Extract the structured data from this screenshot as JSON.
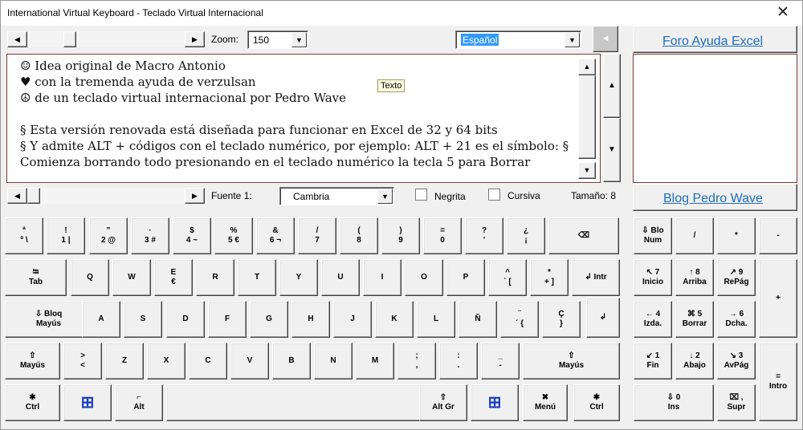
{
  "window": {
    "title": "International Virtual Keyboard - Teclado Virtual Internacional",
    "close_glyph": "✕"
  },
  "toolbar": {
    "zoom_label": "Zoom:",
    "zoom_value": "150",
    "language_value": "Español",
    "collapse_glyph": "◄",
    "arrow_left": "◀",
    "arrow_right": "▶",
    "arrow_down": "▼",
    "arrow_up": "▲"
  },
  "text": {
    "lines": [
      "☺  Idea original de Macro Antonio",
      "♥   con la tremenda ayuda de verzulsan",
      "☮   de un teclado virtual internacional por Pedro Wave",
      "",
      "§    Esta versión renovada está diseñada para funcionar en Excel de 32 y 64 bits",
      "§    Y admite ALT + códigos con el teclado numérico, por ejemplo: ALT + 21 es el símbolo: §",
      "Comienza borrando todo presionando en el teclado numérico la tecla 5 para Borrar"
    ],
    "tooltip": "Texto"
  },
  "fontbar": {
    "font_label": "Fuente 1:",
    "font_value": "Cambria",
    "bold_label": "Negrita",
    "italic_label": "Cursiva",
    "size_label": "Tamaño: 8"
  },
  "links": {
    "forum": "Foro Ayuda Excel",
    "blog": "Blog Pedro Wave"
  },
  "keys": [
    [
      "ª\nº \\",
      "!\n1 |",
      "\"\n2 @",
      "·\n3 #",
      "$\n4 ~",
      "%\n5 €",
      "&\n6 ¬",
      "/\n7",
      "(\n8",
      ")\n9",
      "=\n0",
      "?\n'",
      "¿\n¡",
      "⌫"
    ],
    [
      "⭾\nTab",
      "Q",
      "W",
      "E\n€",
      "R",
      "T",
      "Y",
      "U",
      "I",
      "O",
      "P",
      "^\n` [",
      "*\n+ ]",
      "↲ Intr"
    ],
    [
      "⇩ Bloq\nMayús",
      "A",
      "S",
      "D",
      "F",
      "G",
      "H",
      "J",
      "K",
      "L",
      "Ñ",
      "¨\n´ {",
      "Ç\n}",
      "↲"
    ],
    [
      "⇧\nMayús",
      ">\n<",
      "Z",
      "X",
      "C",
      "V",
      "B",
      "N",
      "M",
      ";\n,",
      ":\n.",
      "_\n-",
      "⇧\nMayús"
    ],
    [
      "✱\nCtrl",
      "⊞",
      "⌐\nAlt",
      "",
      "⇧\nAlt Gr",
      "⊞",
      "✖\nMenú",
      "✱\nCtrl"
    ]
  ],
  "numpad": [
    [
      "⇩ Blo\nNum",
      "/",
      "*",
      "-"
    ],
    [
      "↖ 7\nInicio",
      "↑ 8\nArriba",
      "↗ 9\nRePág",
      "+"
    ],
    [
      "← 4\nIzda.",
      "⌘ 5\nBorrar",
      "→ 6\nDcha."
    ],
    [
      "↙ 1\nFin",
      "↓ 2\nAbajo",
      "↘ 3\nAvPág",
      "=\nIntro"
    ],
    [
      "⇩ 0\nIns",
      "⌧ ,\nSupr"
    ]
  ]
}
